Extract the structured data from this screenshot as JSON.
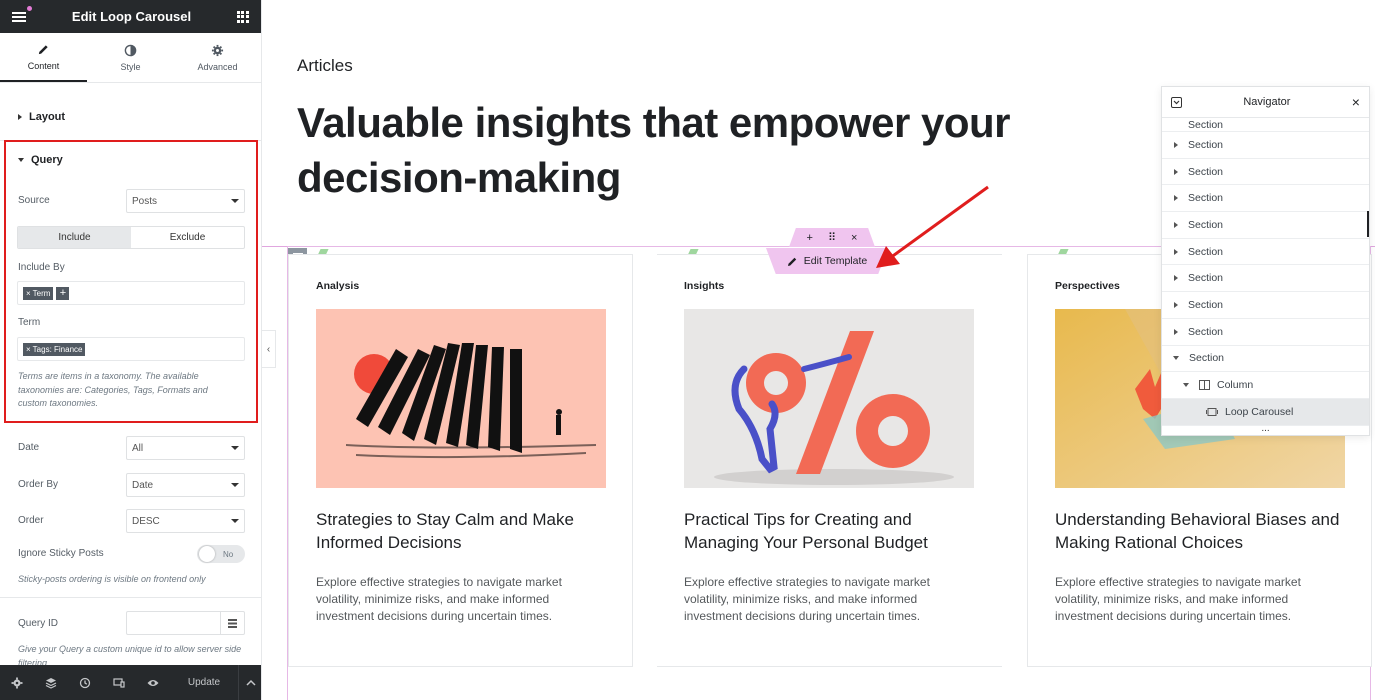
{
  "panel": {
    "title": "Edit Loop Carousel",
    "tabs": [
      {
        "label": "Content",
        "icon": "pencil-icon"
      },
      {
        "label": "Style",
        "icon": "contrast-icon"
      },
      {
        "label": "Advanced",
        "icon": "gear-icon"
      }
    ],
    "layout_section": "Layout",
    "query_section": "Query",
    "source": {
      "label": "Source",
      "value": "Posts"
    },
    "segmented": {
      "include": "Include",
      "exclude": "Exclude"
    },
    "include_by": {
      "label": "Include By",
      "tag": "Term",
      "tag_remove": "×",
      "add": "+"
    },
    "term": {
      "label": "Term",
      "tag": "Tags: Finance",
      "tag_remove": "×"
    },
    "term_help": "Terms are items in a taxonomy. The available taxonomies are: Categories, Tags, Formats and custom taxonomies.",
    "date": {
      "label": "Date",
      "value": "All"
    },
    "order_by": {
      "label": "Order By",
      "value": "Date"
    },
    "order": {
      "label": "Order",
      "value": "DESC"
    },
    "ignore_sticky": {
      "label": "Ignore Sticky Posts",
      "value": "No"
    },
    "sticky_help": "Sticky-posts ordering is visible on frontend only",
    "query_id": {
      "label": "Query ID",
      "value": ""
    },
    "query_id_help": "Give your Query a custom unique id to allow server side filtering",
    "footer": {
      "update": "Update"
    },
    "collapse": "‹"
  },
  "canvas": {
    "eyebrow": "Articles",
    "heading": "Valuable insights that empower your decision-making",
    "toolbar": {
      "add": "+",
      "move": "⠿",
      "close": "×"
    },
    "edit_template": "Edit Template",
    "cards": [
      {
        "category": "Analysis",
        "title": "Strategies to Stay Calm and Make Informed Decisions",
        "excerpt": "Explore effective strategies to navigate market volatility, minimize risks, and make informed investment decisions during uncertain times."
      },
      {
        "category": "Insights",
        "title": "Practical Tips for Creating and Managing Your Personal Budget",
        "excerpt": "Explore effective strategies to navigate market volatility, minimize risks, and make informed investment decisions during uncertain times."
      },
      {
        "category": "Perspectives",
        "title": "Understanding Behavioral Biases and Making Rational Choices",
        "excerpt": "Explore effective strategies to navigate market volatility, minimize risks, and make informed investment decisions during uncertain times."
      }
    ]
  },
  "navigator": {
    "title": "Navigator",
    "close": "×",
    "partial": "Section",
    "sections": [
      "Section",
      "Section",
      "Section",
      "Section",
      "Section",
      "Section",
      "Section",
      "Section"
    ],
    "expanded_section": "Section",
    "column": "Column",
    "loop_carousel": "Loop Carousel",
    "more": "..."
  },
  "colors": {
    "panel_dark": "#26292c",
    "highlight_red": "#e01d1d",
    "widget_pink": "#f0c5ef",
    "card1_bg": "#fdc3b3",
    "accent_coral": "#f26a55"
  }
}
